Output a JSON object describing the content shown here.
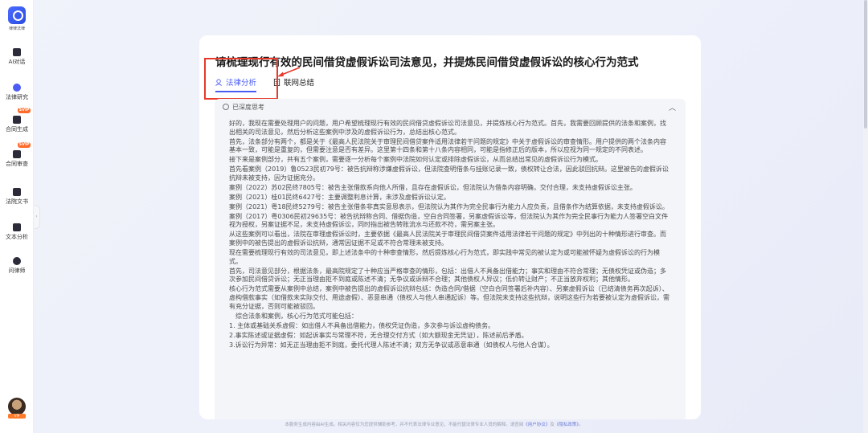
{
  "app": {
    "logo_text": "律律法律"
  },
  "sidebar": {
    "items": [
      {
        "label": "AI对话"
      },
      {
        "label": "法律研究"
      },
      {
        "label": "合同生成",
        "badge": "SVIP"
      },
      {
        "label": "合同审查",
        "badge": "SVIP"
      },
      {
        "label": "法院文书"
      },
      {
        "label": "文本分析"
      },
      {
        "label": "问律师"
      }
    ],
    "avatar_badge": "VIP"
  },
  "main": {
    "title": "请梳理现行有效的民间借贷虚假诉讼司法意见，并提炼民间借贷虚假诉讼的核心行为范式",
    "tabs": [
      {
        "label": "法律分析",
        "active": true
      },
      {
        "label": "联网总结",
        "active": false
      }
    ],
    "think_header": "已深度思考",
    "paragraphs": [
      "好的，我现在需要处理用户的问题，用户希望梳理现行有效的民间借贷虚假诉讼司法意见，并提炼核心行为范式。首先，我需要回顾提供的法条和案例，找出相关的司法意见，然后分析这些案例中涉及的虚假诉讼行为，总结出核心范式。",
      "首先，法条部分有两个，都是关于《最高人民法院关于审理民间借贷案件适用法律若干问题的规定》中关于虚假诉讼的审查情形。用户提供的两个法条内容基本一致，可能是重复的，但需要注意是否有差异。这里第十四条和第十八条内容相同，可能是指修正后的版本，所以应视为同一规定的不同表述。",
      "接下来是案例部分，共有五个案例，需要逐一分析每个案例中法院如何认定或排除虚假诉讼，从而总结出常见的虚假诉讼行为模式。",
      "首先看案例（2019）鲁0523民初79号：被告抗辩称涉嫌虚假诉讼，但法院查明借条与挂账记录一致，债权转让合法，因此驳回抗辩。这里被告的虚假诉讼抗辩未被支持，因为证据充分。",
      "案例（2022）苏02民终7805号：被告主张借款系向他人所借，且存在虚假诉讼，但法院认为借条内容明确，交付合理，未支持虚假诉讼主张。",
      "案例（2021）桂01民终6427号：主要调整利息计算，未涉及虚假诉讼认定。",
      "案例（2021）粤18民终5279号：被告主张借条非真实意思表示，但法院认为其作为完全民事行为能力人应负责，且借条作为结算依据，未支持虚假诉讼。",
      "案例（2017）粤0306民初29635号：被告抗辩称合同、借据伪造，空白合同签署，另案虚假诉讼等，但法院认为其作为完全民事行为能力人签署空白文件视为授权，另案证据不足，未支持虚假诉讼，同时指出被告转账流水与还款不符，需另案主张。",
      "从这些案例可以看出，法院在审理虚假诉讼时，主要依据《最高人民法院关于审理民间借贷案件适用法律若干问题的规定》中列出的十种情形进行审查。而案例中的被告提出的虚假诉讼抗辩，通常因证据不足或不符合常理未被支持。",
      "现在需要梳理现行有效的司法意见，即上述法条中的十种审查情形，然后提炼核心行为范式，即实践中常见的被认定为或可能被怀疑为虚假诉讼的行为模式。",
      "首先，司法意见部分，根据法条，最高院规定了十种应当严格审查的情形，包括：出借人不具备出借能力；事实和理由不符合常理；无债权凭证或伪造；多次参加民间借贷诉讼；无正当理由拒不到庭或陈述不清；无争议或诉辩不合理；其他债权人异议；低价转让财产；不正当放弃权利；其他情形。",
      "核心行为范式需要从案例中总结，案例中被告提出的虚假诉讼抗辩包括：伪造合同/借据（空白合同签署后补内容）、另案虚假诉讼（已结清债务再次起诉）、虚构借款事实（如借款未实际交付、用途虚假）、恶意串通（债权人与他人串通起诉）等。但法院未支持这些抗辩，说明这些行为若要被认定为虚假诉讼，需有充分证据，否则可能被驳回。",
      "综合法条和案例，核心行为范式可能包括：",
      "1. 主体或基础关系虚假：如出借人不具备出借能力，债权凭证伪造，多次参与诉讼虚构债务。",
      "2.事实陈述或证据虚假：如起诉事实与常理不符，无合理交付方式（如大额现金无凭证），陈述前后矛盾。",
      "3.诉讼行为异常：如无正当理由拒不到庭，委托代理人陈述不清；双方无争议或恶意串通（如债权人与他人合谋）。"
    ]
  },
  "footer": {
    "text": "本服务生成内容由AI生成。相关内容仅为您提供辅助参考，并不代表法律专业意见，不能代替法律专业人员的解释。请查阅",
    "link1": "《用户协议》",
    "sep": "及",
    "link2": "《隐私政策》",
    "end": "。"
  },
  "colors": {
    "accent": "#4b5cf5",
    "annotation_red": "#e8392b",
    "vip_orange": "#ff6a2b"
  }
}
